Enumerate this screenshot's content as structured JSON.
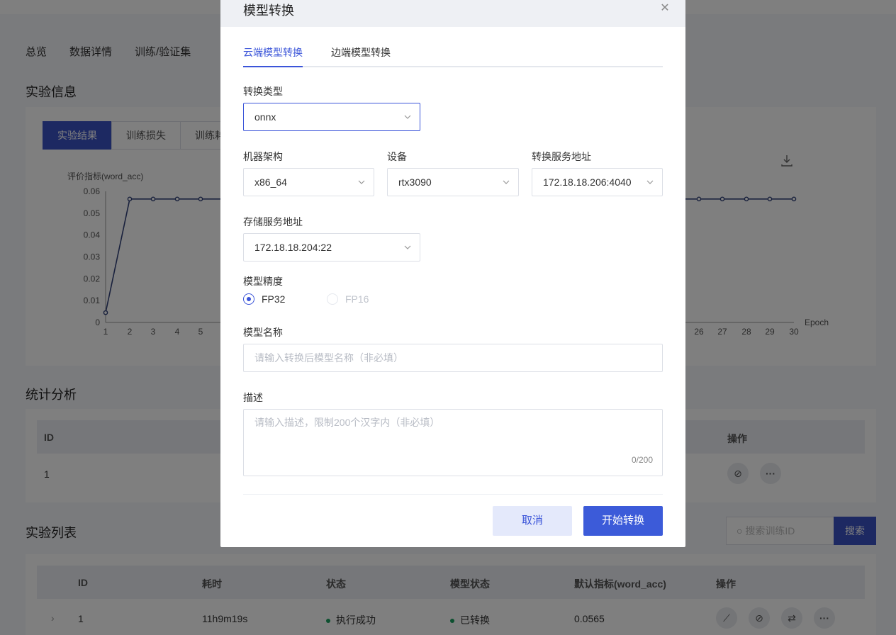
{
  "background": {
    "top_tabs": [
      "总览",
      "数据详情",
      "训练/验证集"
    ],
    "experiment_info_title": "实验信息",
    "chart_tabs": [
      "实验结果",
      "训练损失",
      "训练耗"
    ],
    "chart": {
      "ylabel": "评价指标(word_acc)",
      "xlabel": "Epoch",
      "yticks": [
        "0.06",
        "0.05",
        "0.04",
        "0.03",
        "0.02",
        "0.01",
        "0"
      ],
      "xticks_left": [
        "1",
        "2",
        "3",
        "4",
        "5"
      ],
      "xticks_right": [
        "26",
        "27",
        "28",
        "29",
        "30"
      ]
    },
    "stats_title": "统计分析",
    "stats_table": {
      "headers": [
        "ID",
        "操作"
      ],
      "row_id": "1"
    },
    "exp_list_title": "实验列表",
    "search_placeholder": "搜索训练ID",
    "search_button": "搜索",
    "exp_table": {
      "headers": [
        "ID",
        "耗时",
        "状态",
        "模型状态",
        "默认指标(word_acc)",
        "操作"
      ],
      "row": {
        "id": "1",
        "duration": "11h9m19s",
        "status": "执行成功",
        "model_status": "已转换",
        "metric": "0.0565"
      }
    }
  },
  "chart_data": {
    "type": "line",
    "ylabel": "评价指标(word_acc)",
    "xlabel": "Epoch",
    "ylim": [
      0,
      0.06
    ],
    "x": [
      1,
      2,
      3,
      4,
      5,
      26,
      27,
      28,
      29,
      30
    ],
    "series": [
      {
        "values": [
          0.0045,
          0.0565,
          0.0565,
          0.0565,
          0.0565,
          0.0565,
          0.0565,
          0.0565,
          0.0565,
          0.0565
        ]
      }
    ]
  },
  "modal": {
    "title": "模型转换",
    "tabs": [
      "云端模型转换",
      "边端模型转换"
    ],
    "conversion_type": {
      "label": "转换类型",
      "value": "onnx"
    },
    "arch": {
      "label": "机器架构",
      "value": "x86_64"
    },
    "device": {
      "label": "设备",
      "value": "rtx3090"
    },
    "convert_server": {
      "label": "转换服务地址",
      "value": "172.18.18.206:4040"
    },
    "storage_server": {
      "label": "存储服务地址",
      "value": "172.18.18.204:22"
    },
    "precision": {
      "label": "模型精度",
      "options": [
        "FP32",
        "FP16"
      ],
      "selected": "FP32"
    },
    "model_name": {
      "label": "模型名称",
      "placeholder": "请输入转换后模型名称（非必填）"
    },
    "description": {
      "label": "描述",
      "placeholder": "请输入描述，限制200个汉字内（非必填）",
      "counter": "0/200"
    },
    "cancel_label": "取消",
    "submit_label": "开始转换"
  }
}
